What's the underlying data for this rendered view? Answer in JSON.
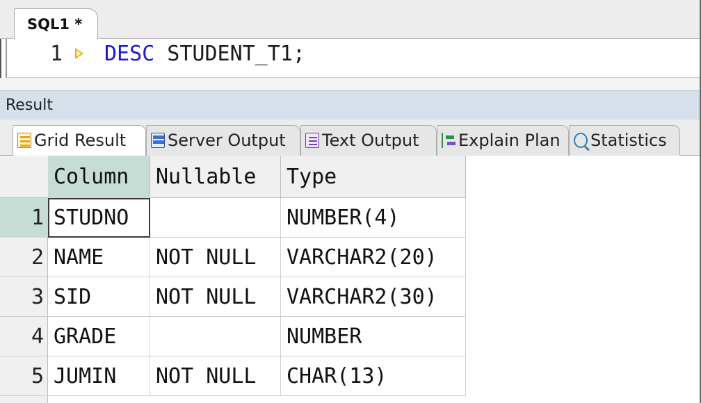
{
  "editor_tab": {
    "label": "SQL1 *"
  },
  "editor": {
    "line_number": "1",
    "keyword": "DESC",
    "statement_rest": " STUDENT_T1;"
  },
  "result_panel": {
    "title": "Result"
  },
  "result_tabs": [
    {
      "label": "Grid Result",
      "icon": "grid-result-icon",
      "active": true
    },
    {
      "label": "Server Output",
      "icon": "server-output-icon",
      "active": false
    },
    {
      "label": "Text Output",
      "icon": "text-output-icon",
      "active": false
    },
    {
      "label": "Explain Plan",
      "icon": "explain-plan-icon",
      "active": false
    },
    {
      "label": "Statistics",
      "icon": "statistics-icon",
      "active": false
    }
  ],
  "grid": {
    "columns": [
      "Column",
      "Nullable",
      "Type"
    ],
    "rows": [
      {
        "num": "1",
        "column": "STUDNO",
        "nullable": "",
        "type": "NUMBER(4)"
      },
      {
        "num": "2",
        "column": "NAME",
        "nullable": "NOT NULL",
        "type": "VARCHAR2(20)"
      },
      {
        "num": "3",
        "column": "SID",
        "nullable": "NOT NULL",
        "type": "VARCHAR2(30)"
      },
      {
        "num": "4",
        "column": "GRADE",
        "nullable": "",
        "type": "NUMBER"
      },
      {
        "num": "5",
        "column": "JUMIN",
        "nullable": "NOT NULL",
        "type": "CHAR(13)"
      }
    ]
  },
  "colors": {
    "keyword": "#1a1ad6",
    "selection": "#c6ddd6",
    "result_bar": "#d5e0ea"
  }
}
